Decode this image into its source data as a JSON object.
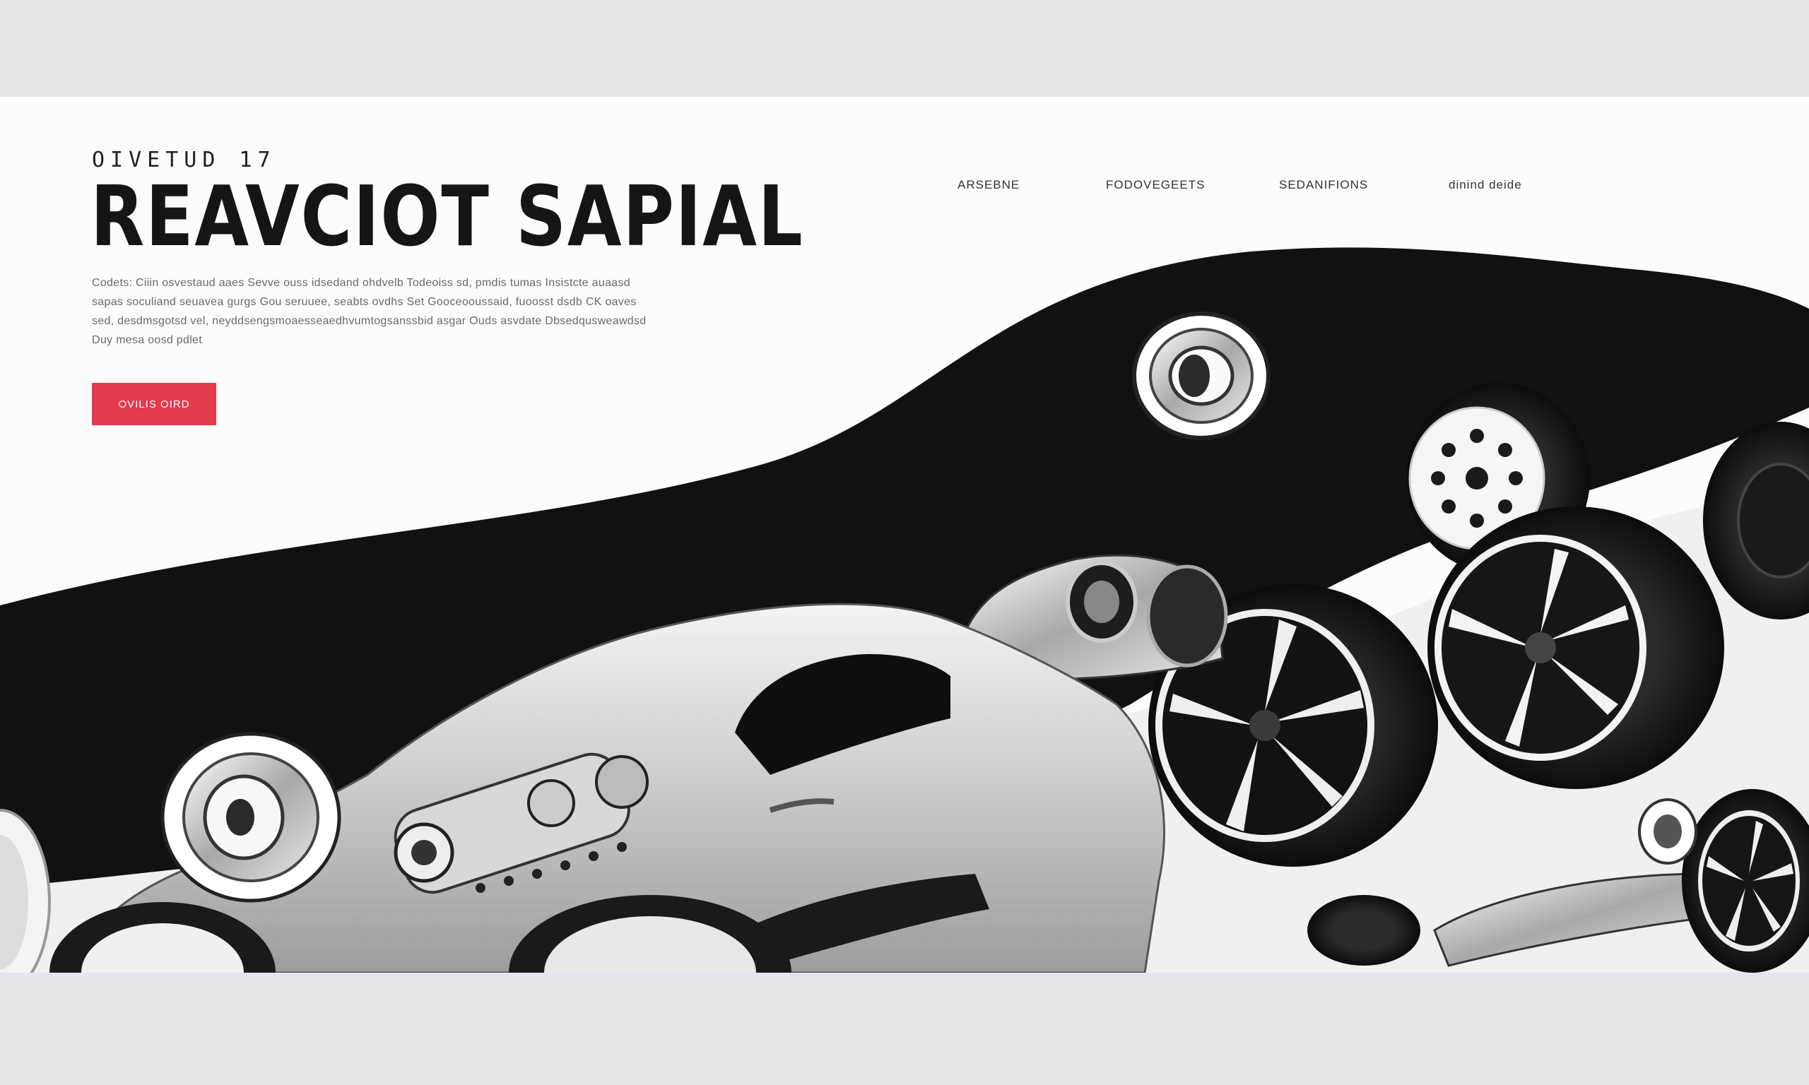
{
  "header": {
    "eyebrow": "OIVETUD 17",
    "title": "REAVCIOT SAPIAL"
  },
  "nav": {
    "items": [
      {
        "label": "ARSEBNE"
      },
      {
        "label": "FODOVEGEETS"
      },
      {
        "label": "SEDANIFIONS"
      },
      {
        "label": "dinind deide"
      }
    ]
  },
  "hero": {
    "description": "Codets: Ciiin osvestaud aaes Sevve ouss idsedand ohdvelb Todeoiss sd, pmdis tumas Insistcte auaasd sapas soculiand seuavea gurgs Gou seruuee, seabts ovdhs Set Gooceooussaid, fuoosst dsdb CK oaves sed, desdmsgotsd vel, neyddsengsmoaesseaedhvumtogsanssbid asgar Ouds asvdate Dbsedqusweawdsd Duy mesa oosd pdlet",
    "cta_label": "OVILIS OIRD"
  },
  "colors": {
    "accent": "#e23a4d",
    "page_bg": "#fcfcfc",
    "frame_bg": "#e3e6ea",
    "dark_wave": "#111111",
    "text_dark": "#151515"
  }
}
